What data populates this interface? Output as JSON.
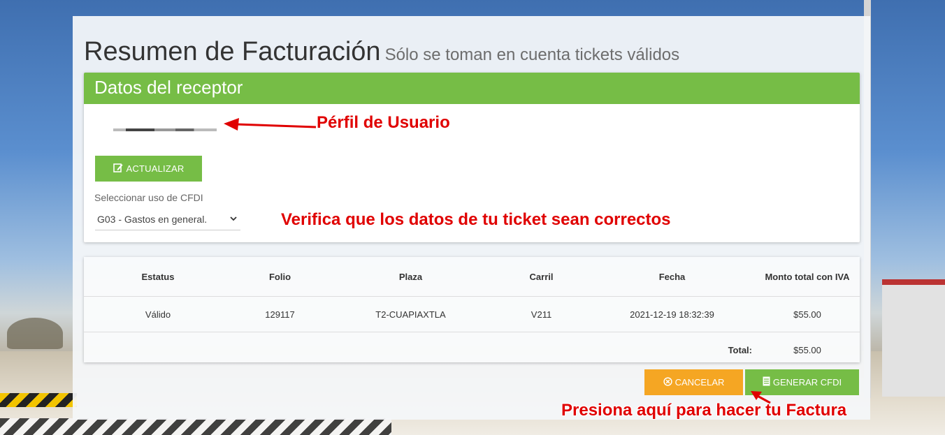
{
  "page": {
    "title": "Resumen de Facturación",
    "subtitle": "Sólo se toman en cuenta tickets válidos"
  },
  "receptor": {
    "header": "Datos del receptor",
    "update_button": "ACTUALIZAR",
    "cfdi_label": "Seleccionar uso de CFDI",
    "cfdi_selected": "G03 - Gastos en general."
  },
  "annotations": {
    "profile": "Pérfil de Usuario",
    "verify": "Verifica que los datos de tu ticket sean correctos",
    "press": "Presiona aquí para hacer tu Factura"
  },
  "table": {
    "headers": [
      "Estatus",
      "Folio",
      "Plaza",
      "Carril",
      "Fecha",
      "Monto total con IVA"
    ],
    "rows": [
      [
        "Válido",
        "129117",
        "T2-CUAPIAXTLA",
        "V211",
        "2021-12-19 18:32:39",
        "$55.00"
      ]
    ],
    "total_label": "Total:",
    "total_value": "$55.00"
  },
  "actions": {
    "cancel": "CANCELAR",
    "generate": "GENERAR CFDI"
  },
  "colors": {
    "green": "#76bd46",
    "orange": "#f5a623",
    "annotation_red": "#e00000"
  }
}
